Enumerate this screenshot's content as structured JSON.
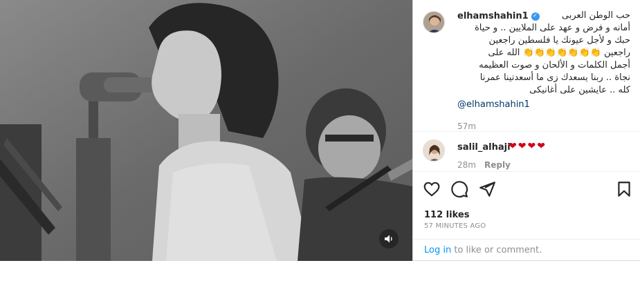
{
  "post": {
    "author": "elhamshahin1",
    "caption": "حب الوطن العربى\nأمانه و فرض و عهد على الملايين .. و حياة\nحبك و لأجل عيونك يا فلسطين راجعين\nراجعين 👏👏👏👏👏👏👏 الله على\nأجمل الكلمات و الألحان و صوت العظيمه\nنجاة .. ربنا يسعدك زى ما أسعدتينا عمرنا\nكله .. عايشين على أغانيكى",
    "mention": "@elhamshahin1",
    "time": "57m",
    "likes": "112 likes",
    "posted_ago": "57 MINUTES AGO"
  },
  "comment": {
    "user": "salil_alhaji",
    "hearts": [
      "❤",
      "❤",
      "❤",
      "❤"
    ],
    "time": "28m",
    "reply": "Reply"
  },
  "footer": {
    "login_link": "Log in",
    "login_text": " to like or comment."
  },
  "icons": {
    "like": "heart-outline-icon",
    "comment": "speech-bubble-icon",
    "share": "paper-plane-icon",
    "save": "bookmark-icon",
    "sound": "speaker-icon",
    "verified": "verified-badge-icon"
  },
  "colors": {
    "link": "#0095f6",
    "mention": "#00376b",
    "verified": "#3897f0",
    "heart": "#d0021b",
    "muted": "#8e8e8e"
  }
}
